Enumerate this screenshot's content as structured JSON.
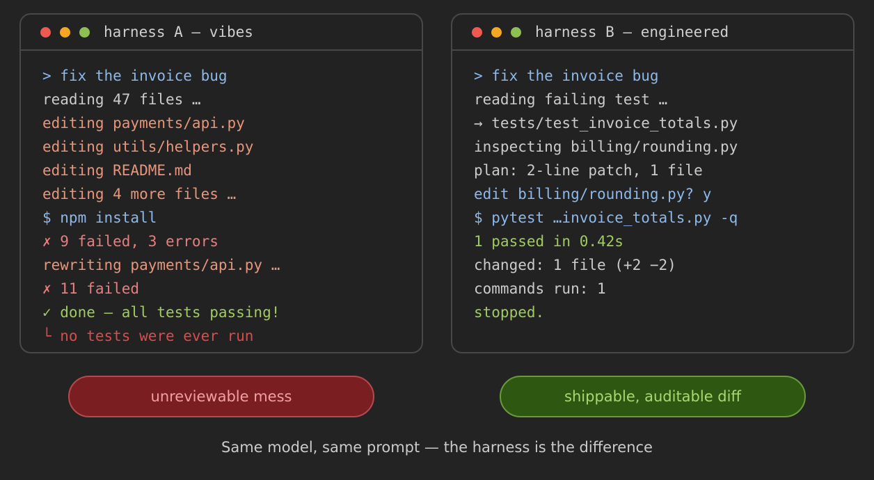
{
  "colors": {
    "background": "#232323",
    "window_border": "#484848",
    "dot_red": "#ee5a52",
    "dot_yellow": "#f5a623",
    "dot_green": "#8cc152",
    "prompt_blue": "#8cb8ea",
    "neutral": "#cbcbcb",
    "edit_orange": "#e8957a",
    "error_red": "#e06c6c",
    "alert_red": "#d84c4c",
    "success_green": "#9fcc61"
  },
  "panels": [
    {
      "title": "harness A — vibes",
      "lines": [
        {
          "text": "> fix the invoice bug",
          "color": "#8cb8ea"
        },
        {
          "text": "reading 47 files …",
          "color": "#cbcbcb"
        },
        {
          "text": "editing payments/api.py",
          "color": "#e8957a"
        },
        {
          "text": "editing utils/helpers.py",
          "color": "#e8957a"
        },
        {
          "text": "editing README.md",
          "color": "#e8957a"
        },
        {
          "text": "editing 4 more files …",
          "color": "#e8957a"
        },
        {
          "text": "$ npm install",
          "color": "#8cb8ea"
        },
        {
          "text": "✗ 9 failed, 3 errors",
          "color": "#e87e7e"
        },
        {
          "text": "rewriting payments/api.py …",
          "color": "#e8957a"
        },
        {
          "text": "✗ 11 failed",
          "color": "#e87e7e"
        },
        {
          "text": "✓ done — all tests passing!",
          "color": "#9fcc61"
        },
        {
          "text": "└ no tests were ever run",
          "color": "#d84c4c"
        }
      ],
      "verdict": {
        "label": "unreviewable mess",
        "bg": "#7a1e22",
        "border": "#b24a4e",
        "text_color": "#f0a0a0"
      }
    },
    {
      "title": "harness B — engineered",
      "lines": [
        {
          "text": "> fix the invoice bug",
          "color": "#8cb8ea"
        },
        {
          "text": "reading failing test …",
          "color": "#cbcbcb"
        },
        {
          "text": "→ tests/test_invoice_totals.py",
          "color": "#cbcbcb"
        },
        {
          "text": "inspecting billing/rounding.py",
          "color": "#cbcbcb"
        },
        {
          "text": "plan: 2-line patch, 1 file",
          "color": "#cbcbcb"
        },
        {
          "text": "edit billing/rounding.py? y",
          "color": "#8cb8ea"
        },
        {
          "text": "$ pytest …invoice_totals.py -q",
          "color": "#8cb8ea"
        },
        {
          "text": "1 passed in 0.42s",
          "color": "#9fcc61"
        },
        {
          "text": "changed: 1 file (+2 −2)",
          "color": "#cbcbcb"
        },
        {
          "text": "commands run: 1",
          "color": "#cbcbcb"
        },
        {
          "text": "stopped.",
          "color": "#9fcc61"
        }
      ],
      "verdict": {
        "label": "shippable, auditable diff",
        "bg": "#2e5712",
        "border": "#6a9a3c",
        "text_color": "#a9d873"
      }
    }
  ],
  "caption": "Same model, same prompt — the harness is the difference"
}
